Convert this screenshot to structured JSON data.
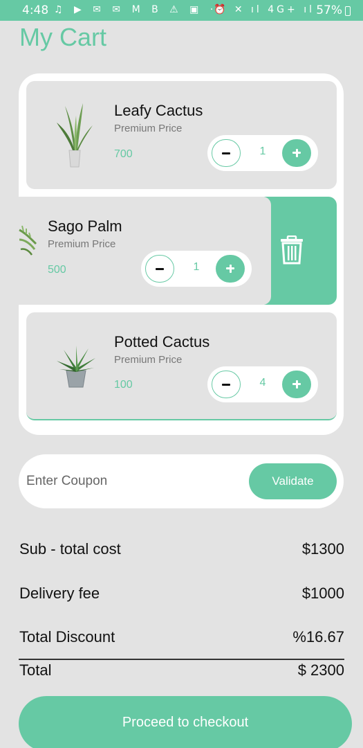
{
  "status_bar": {
    "time": "4:48",
    "notification_icons": "♫ ▶ ✉ ✉ M B ⚠ ▣ ··",
    "system_icons": "⏰ ✕ ıl 4G+ ıl",
    "battery": "57%"
  },
  "page": {
    "title": "My Cart"
  },
  "cart": {
    "items": [
      {
        "name": "Leafy Cactus",
        "subtitle": "Premium Price",
        "price": "700",
        "quantity": "1",
        "image": "snake-plant"
      },
      {
        "name": "Sago Palm",
        "subtitle": "Premium Price",
        "price": "500",
        "quantity": "1",
        "image": "sago-palm"
      },
      {
        "name": "Potted Cactus",
        "subtitle": "Premium Price",
        "price": "100",
        "quantity": "4",
        "image": "aloe-plant"
      }
    ],
    "delete_icon": "trash-icon"
  },
  "coupon": {
    "placeholder": "Enter Coupon",
    "value": "",
    "button_label": "Validate"
  },
  "summary": {
    "subtotal_label": "Sub - total cost",
    "subtotal_value": "$1300",
    "delivery_label": "Delivery fee",
    "delivery_value": "$1000",
    "discount_label": "Total Discount",
    "discount_value": "%16.67",
    "total_label": "Total",
    "total_value": "$ 2300"
  },
  "checkout": {
    "label": "Proceed to checkout"
  },
  "colors": {
    "accent": "#66c9a4",
    "background": "#e3e3e3",
    "panel": "#ffffff"
  }
}
